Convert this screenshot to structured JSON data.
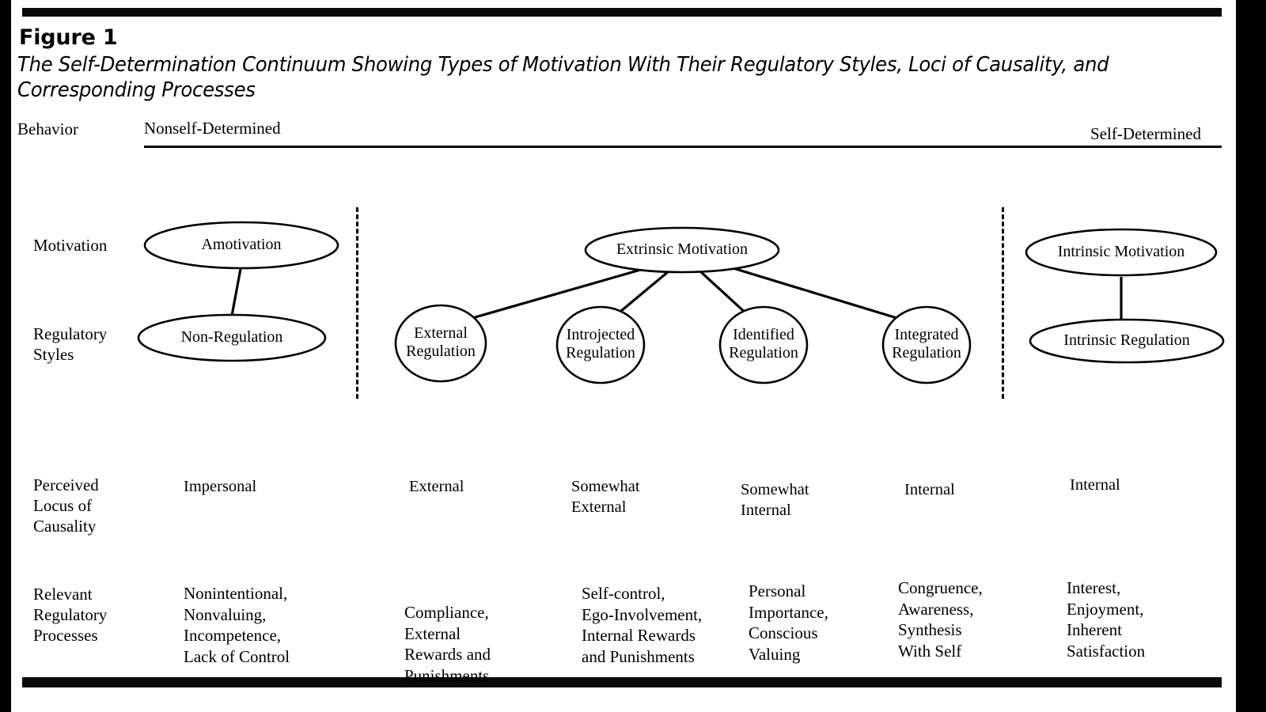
{
  "figure": {
    "label": "Figure 1",
    "title": "The Self-Determination Continuum Showing Types of Motivation With Their Regulatory Styles, Loci of Causality, and Corresponding Processes"
  },
  "row_labels": {
    "behavior": "Behavior",
    "motivation": "Motivation",
    "regulatory_styles": "Regulatory\nStyles",
    "perceived_locus": "Perceived\nLocus of\nCausality",
    "relevant_processes": "Relevant\nRegulatory\nProcesses"
  },
  "continuum": {
    "left_end": "Nonself-Determined",
    "right_end": "Self-Determined"
  },
  "motivation_nodes": {
    "amotivation": "Amotivation",
    "extrinsic": "Extrinsic Motivation",
    "intrinsic": "Intrinsic Motivation"
  },
  "regulation_nodes": {
    "non_regulation": "Non-Regulation",
    "external": "External\nRegulation",
    "introjected": "Introjected\nRegulation",
    "identified": "Identified\nRegulation",
    "integrated": "Integrated\nRegulation",
    "intrinsic": "Intrinsic Regulation"
  },
  "perceived_locus_of_causality": [
    "Impersonal",
    "External",
    "Somewhat\nExternal",
    "Somewhat\nInternal",
    "Internal",
    "Internal"
  ],
  "relevant_regulatory_processes": [
    "Nonintentional,\nNonvaluing,\nIncompetence,\nLack of Control",
    "Compliance,\nExternal\nRewards and\nPunishments",
    "Self-control,\nEgo-Involvement,\nInternal Rewards\nand Punishments",
    "Personal\nImportance,\nConscious\nValuing",
    "Congruence,\nAwareness,\nSynthesis\nWith Self",
    "Interest,\nEnjoyment,\nInherent\nSatisfaction"
  ],
  "colors": {
    "ink": "#000000",
    "paper": "#ffffff"
  }
}
